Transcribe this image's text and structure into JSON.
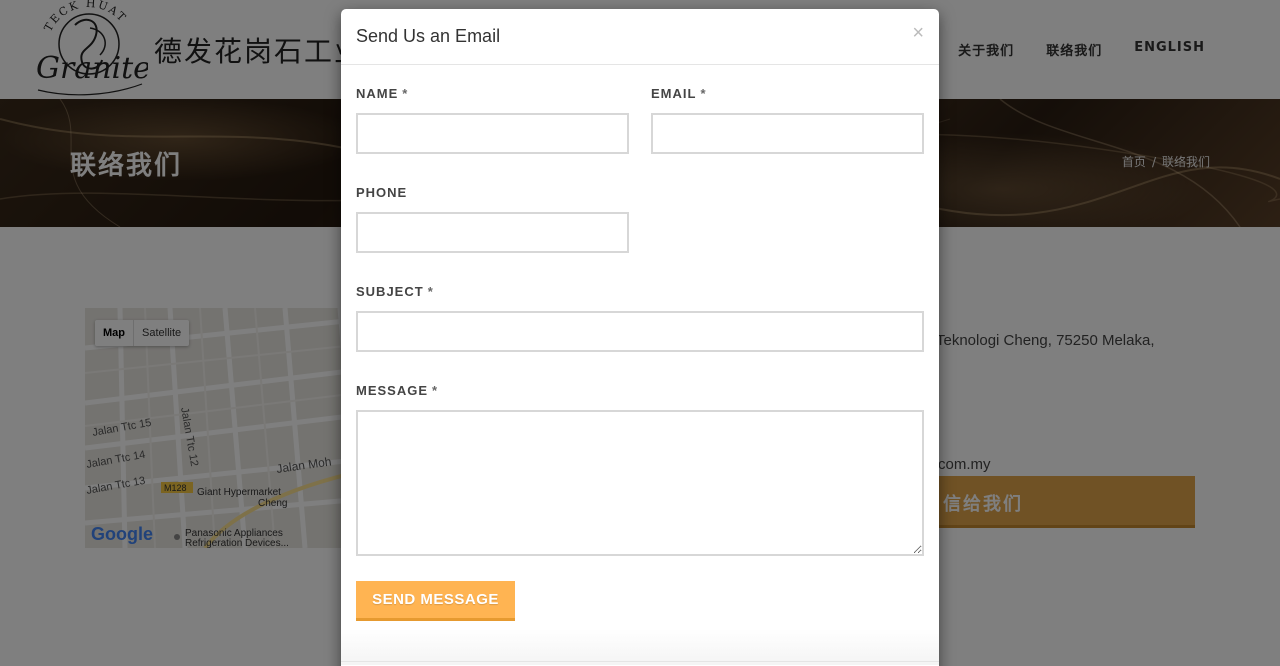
{
  "header": {
    "logo": {
      "arc_text": "TECK HUAT",
      "script_text": "Granite"
    },
    "brand_name": "德发花岗石工业",
    "nav": [
      {
        "label": "关于我们"
      },
      {
        "label": "联络我们"
      },
      {
        "label": "ENGLISH"
      }
    ]
  },
  "banner": {
    "title": "联络我们",
    "breadcrumb": {
      "home": "首页",
      "separator": "/",
      "current": "联络我们"
    }
  },
  "map": {
    "types": [
      "Map",
      "Satellite"
    ],
    "labels": {
      "ttc15": "Jalan Ttc 15",
      "ttc14": "Jalan Ttc 14",
      "ttc13": "Jalan Ttc 13",
      "ttc12": "Jalan Ttc 12",
      "mohd": "Jalan Moh",
      "m128": "M128",
      "giant": "Giant Hypermarket",
      "cheng": "Cheng",
      "panasonic1": "Panasonic Appliances",
      "panasonic2": "Refrigeration Devices..."
    },
    "google_logo": "Google"
  },
  "contact": {
    "address_fragment": "Teknologi Cheng, 75250 Melaka,",
    "email_fragment": "com.my",
    "cta_label": "信给我们"
  },
  "modal": {
    "title": "Send Us an Email",
    "close": "×",
    "fields": {
      "name": {
        "label": "NAME",
        "required": "*",
        "value": ""
      },
      "email": {
        "label": "EMAIL",
        "required": "*",
        "value": ""
      },
      "phone": {
        "label": "PHONE",
        "value": ""
      },
      "subject": {
        "label": "SUBJECT",
        "required": "*",
        "value": ""
      },
      "message": {
        "label": "MESSAGE",
        "required": "*",
        "value": ""
      }
    },
    "submit_label": "SEND MESSAGE"
  },
  "colors": {
    "accent": "#ffb452",
    "cta": "#e0a44a",
    "overlay": "rgba(0,0,0,0.5)"
  }
}
